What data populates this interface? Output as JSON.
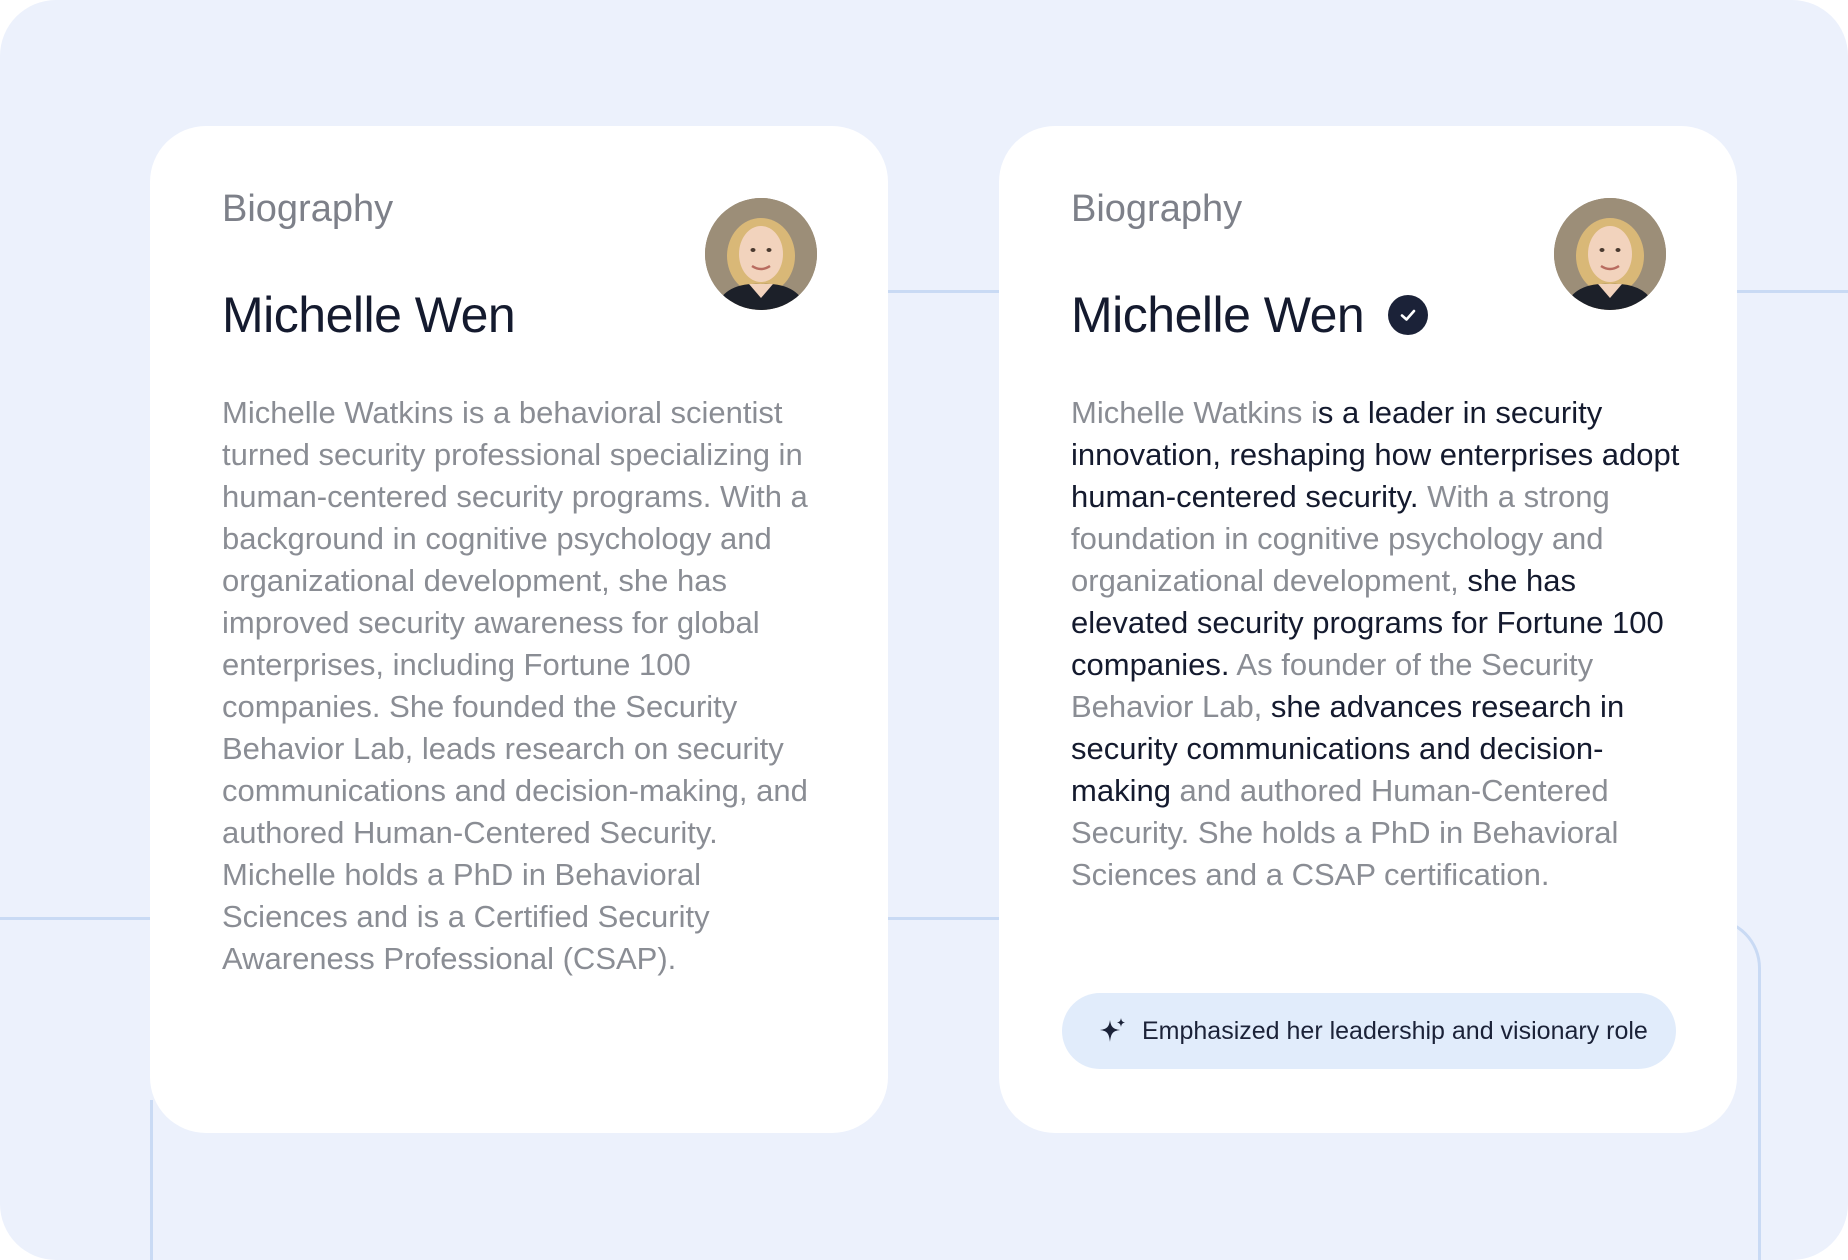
{
  "cards": [
    {
      "section_label": "Biography",
      "name": "Michelle Wen",
      "bio_segments": [
        {
          "text": "Michelle Watkins is a behavioral scientist turned security professional specializing in human-centered security programs. With a background in cognitive psychology and organizational development, she has improved security awareness for global enterprises, including Fortune 100 companies. She founded the Security Behavior Lab, leads research on security communications and decision-making, and authored Human-Centered Security. Michelle holds a PhD in Behavioral Sciences and is a Certified Security Awareness Professional (CSAP).",
          "emphasis": false
        }
      ]
    },
    {
      "section_label": "Biography",
      "name": "Michelle Wen",
      "bio_segments": [
        {
          "text": "Michelle Watkins i",
          "emphasis": false
        },
        {
          "text": "s a leader in security innovation, reshaping how enterprises adopt human-centered security.",
          "emphasis": true
        },
        {
          "text": " With a strong foundation in cognitive psychology and organizational development, ",
          "emphasis": false
        },
        {
          "text": "she has elevated security programs for Fortune 100 companies.",
          "emphasis": true
        },
        {
          "text": " As founder of the Security Behavior Lab, ",
          "emphasis": false
        },
        {
          "text": "she advances research in security communications and decision-making",
          "emphasis": true
        },
        {
          "text": " and authored Human-Centered Security. She holds a PhD in Behavioral Sciences and a CSAP certification.",
          "emphasis": false
        }
      ],
      "change_summary": "Emphasized her leadership and visionary role"
    }
  ],
  "icons": {
    "verified": "check-circle-icon",
    "summary": "sparkle-icon"
  },
  "colors": {
    "background": "#ecf1fc",
    "emphasis_text": "#141a2e",
    "muted_text": "#8a8d94",
    "chip_background": "#e1ecfb"
  }
}
